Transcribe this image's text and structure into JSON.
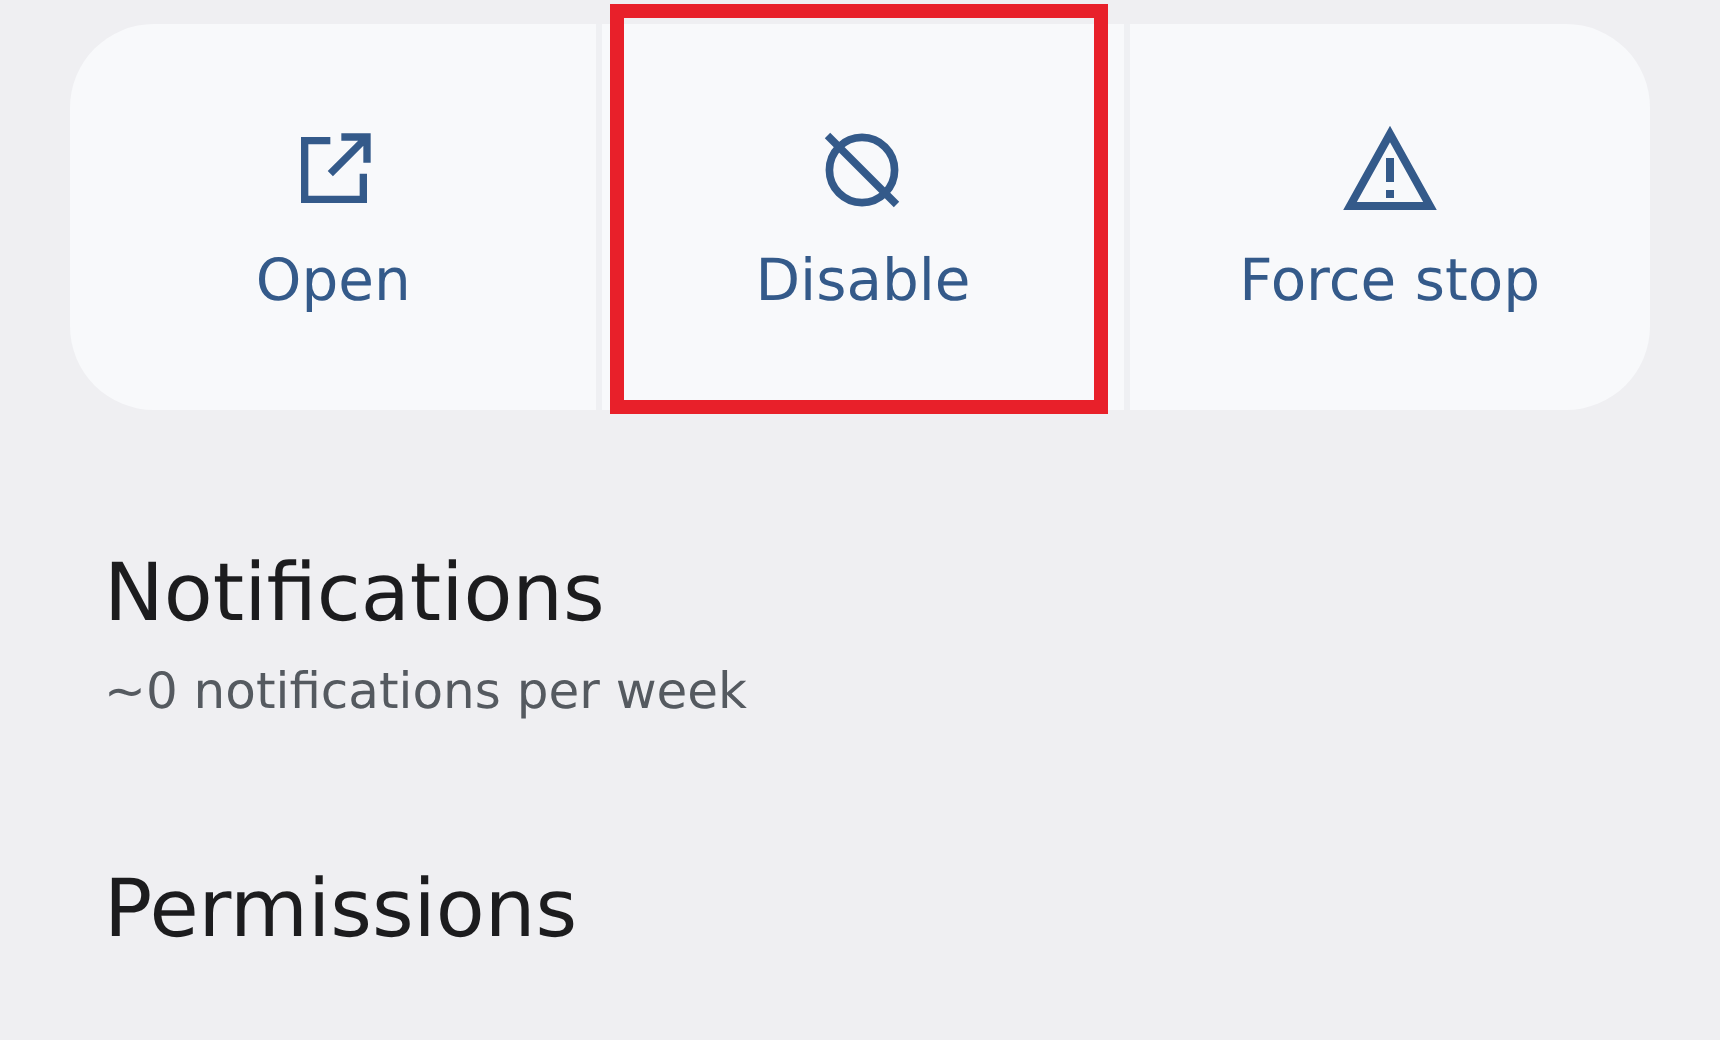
{
  "actions": [
    {
      "kind": "open",
      "label": "Open",
      "highlighted": false
    },
    {
      "kind": "disable",
      "label": "Disable",
      "highlighted": true
    },
    {
      "kind": "warning",
      "label": "Force stop",
      "highlighted": false
    }
  ],
  "settings": [
    {
      "title": "Notifications",
      "summary": "~0 notifications per week"
    },
    {
      "title": "Permissions"
    }
  ]
}
